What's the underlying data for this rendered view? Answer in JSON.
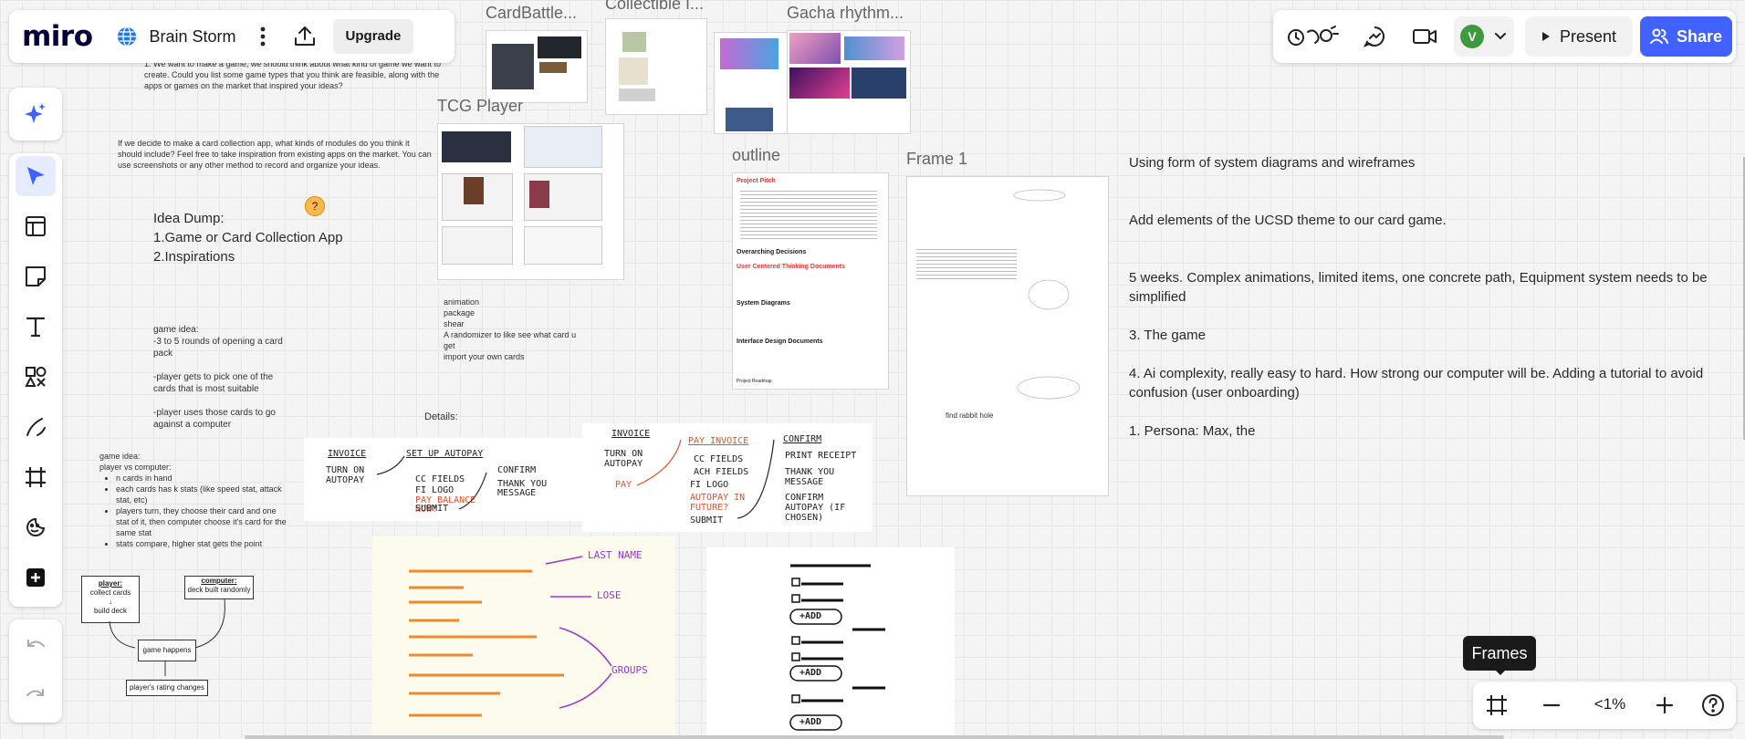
{
  "app": {
    "logo_text": "miro",
    "board_name": "Brain Storm",
    "upgrade_label": "Upgrade"
  },
  "header_right": {
    "avatar_letter": "V",
    "present_label": "Present",
    "share_label": "Share"
  },
  "zoom": {
    "level": "<1%",
    "tooltip": "Frames"
  },
  "frames": {
    "cardbattle": "CardBattle...",
    "collectible": "Collectible I...",
    "gacha": "Gacha rhythm...",
    "tcg": "TCG Player",
    "outline": "outline",
    "frame1": "Frame 1"
  },
  "board_text": {
    "q1": "1. We want to make a game, we should think about what kind of game we want to create. Could you list some game types that you think are feasible, along with the apps or games on the market that inspired your ideas?",
    "q2": "If we decide to make a card collection app, what kinds of modules do you think it should include? Feel free to take inspiration from existing apps on the market. You can use screenshots or any other method to record and organize your ideas.",
    "idea_title": "Idea Dump:",
    "idea_1": "1.Game or Card Collection App",
    "idea_2": "2.Inspirations",
    "game_idea_1": "game idea:\n-3 to 5 rounds of opening a card pack\n\n-player gets to pick one of the cards that is most suitable\n\n-player uses those cards to go against a computer",
    "anim_note": "animation\npackage\nshear\nA randomizer to like see what card u get\nimport your own cards",
    "details": "Details:",
    "game_idea_2_title": "game idea:",
    "game_idea_2_sub": "player vs computer:",
    "game_idea_2_items": [
      "n cards in hand",
      "each cards has k stats (like speed stat, attack stat, etc)",
      "players turn, they choose their card and one stat of it, then computer choose it's card for the same stat",
      "stats compare, higher stat gets the point"
    ],
    "flow_player": "player:",
    "flow_player_sub": "collect cards\n↓\nbuild deck",
    "flow_computer": "computer:",
    "flow_computer_sub": "deck built randomly",
    "flow_game": "game happens",
    "flow_rating": "player's rating changes"
  },
  "outline_doc": {
    "title": "Project Pitch",
    "section1": "Overarching Decisions",
    "section2": "User Centered Thinking Documents",
    "section3": "System Diagrams",
    "section4": "Interface Design Documents",
    "footer": "Project Roadmap"
  },
  "frame1_text": {
    "label": "find rabbit hole"
  },
  "sketch1": {
    "invoice": "INVOICE",
    "turn_on": "TURN ON AUTOPAY",
    "setup": "SET UP AUTOPAY",
    "cc": "CC FIELDS",
    "fi": "FI LOGO",
    "pay_balance": "PAY BALANCE NOW?",
    "submit": "SUBMIT",
    "confirm": "CONFIRM",
    "thank": "THANK YOU MESSAGE"
  },
  "sketch2": {
    "invoice": "INVOICE",
    "turn_on": "TURN ON AUTOPAY",
    "pay": "PAY",
    "pay_invoice": "PAY INVOICE",
    "cc": "CC FIELDS",
    "ach": "ACH FIELDS",
    "fi": "FI LOGO",
    "autopay_future": "AUTOPAY IN FUTURE?",
    "submit": "SUBMIT",
    "confirm": "CONFIRM",
    "print": "PRINT RECEIPT",
    "thank": "THANK YOU MESSAGE",
    "confirm_autopay": "CONFIRM AUTOPAY (IF CHOSEN)"
  },
  "sketch3": {
    "last_name": "LAST NAME",
    "lose": "LOSE",
    "groups": "GROUPS"
  },
  "sketch4": {
    "add_1": "+ADD",
    "add_2": "+ADD",
    "add_3": "+ADD"
  },
  "right_notes": {
    "n1": "Using form of system diagrams and wireframes",
    "n2": "Add elements of the UCSD theme to our card game.",
    "n3": "5 weeks. Complex animations, limited items, one concrete path, Equipment system needs to be simplified",
    "n4": "3. The game",
    "n5": "4.  Ai complexity, really easy to hard. How strong our computer will be. Adding a tutorial to avoid confusion (user onboarding)",
    "n6": "1. Persona: Max, the"
  },
  "colors": {
    "accent": "#4262ff",
    "ai": "#4262ff",
    "present_bg": "#f2f2f2",
    "avatar_bg": "#3d9a3d"
  },
  "icons": [
    "globe-icon",
    "more-vertical-icon",
    "upload-icon",
    "ai-sparkle-icon",
    "select-cursor-icon",
    "templates-icon",
    "sticky-note-icon",
    "text-icon",
    "shapes-icon",
    "pen-icon",
    "frame-icon",
    "emoji-icon",
    "add-icon",
    "undo-icon",
    "redo-icon",
    "reactions-icon",
    "chat-icon",
    "video-icon",
    "chevron-down-icon",
    "play-icon",
    "users-icon",
    "frames-icon",
    "zoom-out-icon",
    "zoom-in-icon",
    "help-icon"
  ]
}
